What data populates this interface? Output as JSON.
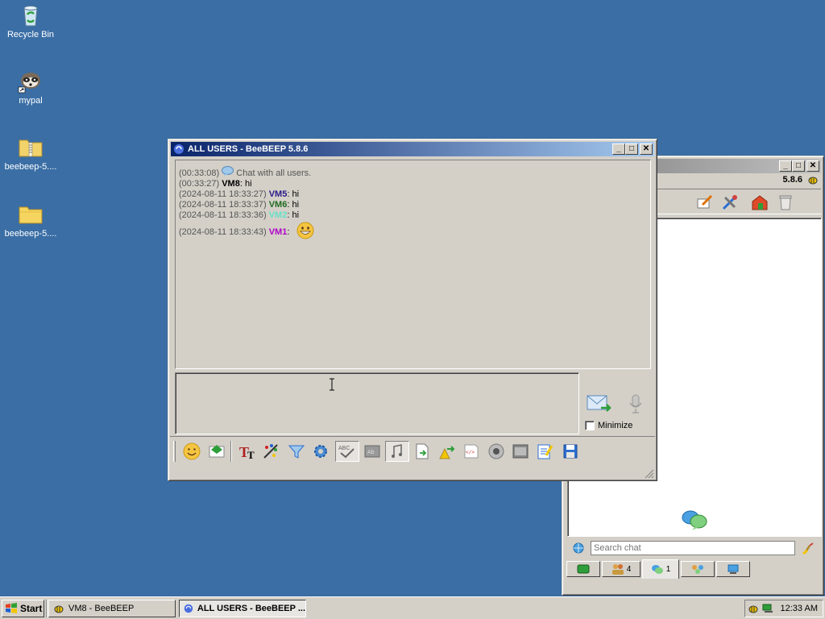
{
  "desktop": {
    "icons": [
      {
        "label": "Recycle Bin",
        "icon": "recycle-bin-icon"
      },
      {
        "label": "mypal",
        "icon": "mypal-raccoon-icon"
      },
      {
        "label": "beebeep-5....",
        "icon": "zip-folder-icon"
      },
      {
        "label": "beebeep-5....",
        "icon": "folder-icon"
      }
    ]
  },
  "chat_window": {
    "title": "ALL USERS - BeeBEEP 5.8.6",
    "messages": [
      {
        "time": "(00:33:08)",
        "user": "",
        "text": "Chat with all users.",
        "user_color": "#000000",
        "system": true
      },
      {
        "time": "(00:33:27)",
        "user": "VM8",
        "text": ": hi",
        "user_color": "#000000"
      },
      {
        "time": "(2024-08-11 18:33:27)",
        "user": "VM5",
        "text": ": hi",
        "user_color": "#2a1a8a"
      },
      {
        "time": "(2024-08-11 18:33:37)",
        "user": "VM6",
        "text": ": hi",
        "user_color": "#1f6b1f"
      },
      {
        "time": "(2024-08-11 18:33:36)",
        "user": "VM2",
        "text": ": hi",
        "user_color": "#66e0c8"
      },
      {
        "time": "(2024-08-11 18:33:43)",
        "user": "VM1",
        "text": ":",
        "user_color": "#b000c8",
        "emoji": "grinning-face"
      }
    ],
    "minimize_label": "Minimize",
    "toolbar_icons": [
      "smiley-icon",
      "send-file-icon",
      "font-icon",
      "color-palette-icon",
      "filter-icon",
      "settings-gear-icon",
      "spell-check-icon",
      "word-completion-icon",
      "music-note-icon",
      "share-file-icon",
      "share-desktop-icon",
      "note-icon",
      "html-icon",
      "record-icon",
      "screenshot-icon",
      "clipboard-icon",
      "save-icon"
    ]
  },
  "main_window": {
    "version": "5.8.6",
    "search_placeholder": "Search chat",
    "tabs": [
      {
        "icon": "users-green-icon",
        "count": ""
      },
      {
        "icon": "users-icon",
        "count": "4"
      },
      {
        "icon": "chat-bubbles-icon",
        "count": "1"
      },
      {
        "icon": "groups-icon",
        "count": ""
      },
      {
        "icon": "network-icon",
        "count": ""
      }
    ]
  },
  "taskbar": {
    "start_label": "Start",
    "tasks": [
      {
        "label": "VM8 - BeeBEEP",
        "active": false
      },
      {
        "label": "ALL USERS - BeeBEEP ...",
        "active": true
      }
    ],
    "clock": "12:33 AM"
  }
}
